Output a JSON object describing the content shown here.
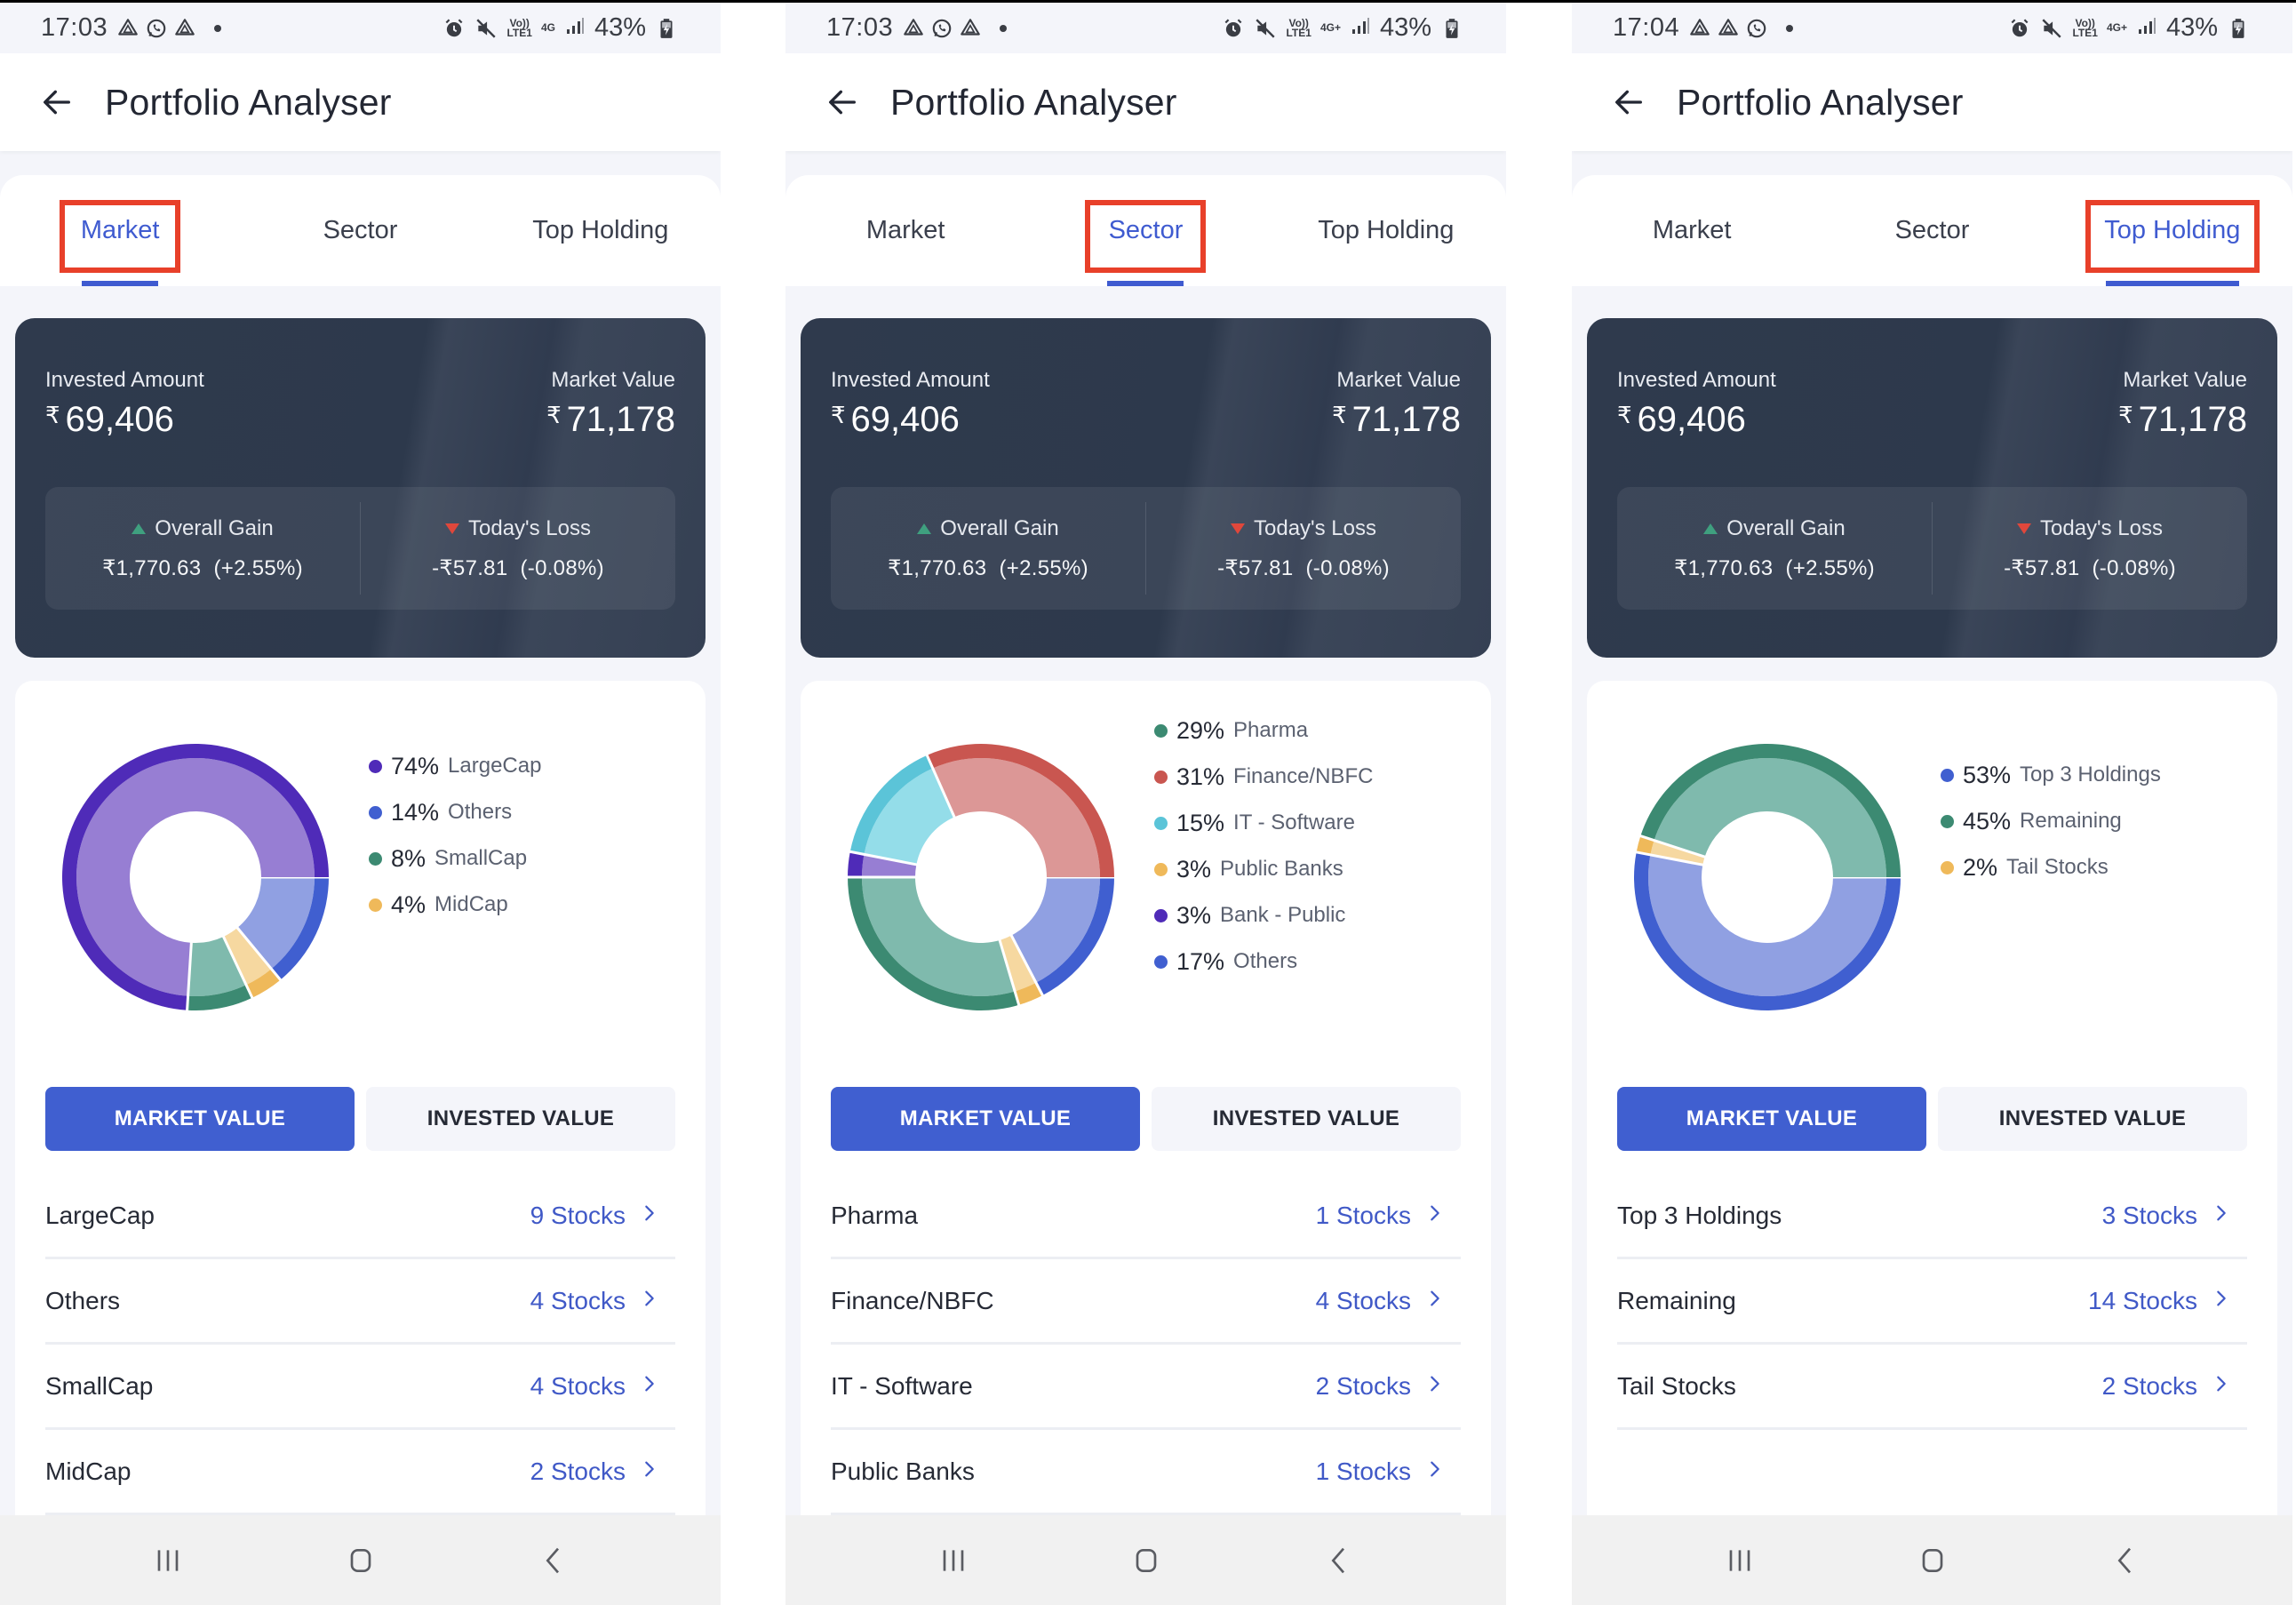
{
  "app": {
    "title": "Portfolio Analyser"
  },
  "tabs": [
    "Market",
    "Sector",
    "Top Holding"
  ],
  "summary": {
    "invested_label": "Invested Amount",
    "invested_value": "69,406",
    "market_label": "Market Value",
    "market_value": "71,178",
    "currency": "₹",
    "gain_label": "Overall Gain",
    "gain_value": "₹1,770.63",
    "gain_pct": "(+2.55%)",
    "loss_label": "Today's Loss",
    "loss_value": "-₹57.81",
    "loss_pct": "(-0.08%)"
  },
  "buttons": {
    "market_value": "MARKET VALUE",
    "invested_value": "INVESTED VALUE"
  },
  "nav": {
    "recents": "recents-icon",
    "home": "home-icon",
    "back": "back-icon"
  },
  "colors": {
    "accent": "#405fd0",
    "highlight": "#e8402a",
    "card_dark": "#2f3a4d",
    "gain": "#3fa07f",
    "loss": "#e0473b"
  },
  "panels": [
    {
      "status": {
        "time": "17:03",
        "network": "4G",
        "battery": "43%",
        "notif_icons": [
          "drive-icon",
          "whatsapp-icon",
          "drive-icon"
        ]
      },
      "active_tab": 0,
      "legend": [
        {
          "pct": "74%",
          "name": "LargeCap"
        },
        {
          "pct": "14%",
          "name": "Others"
        },
        {
          "pct": "8%",
          "name": "SmallCap"
        },
        {
          "pct": "4%",
          "name": "MidCap"
        }
      ],
      "rows": [
        {
          "name": "LargeCap",
          "count": "9 Stocks"
        },
        {
          "name": "Others",
          "count": "4 Stocks"
        },
        {
          "name": "SmallCap",
          "count": "4 Stocks"
        },
        {
          "name": "MidCap",
          "count": "2 Stocks"
        }
      ]
    },
    {
      "status": {
        "time": "17:03",
        "network": "4G+",
        "battery": "43%",
        "notif_icons": [
          "drive-icon",
          "whatsapp-icon",
          "drive-icon"
        ]
      },
      "active_tab": 1,
      "legend": [
        {
          "pct": "29%",
          "name": "Pharma"
        },
        {
          "pct": "31%",
          "name": "Finance/NBFC"
        },
        {
          "pct": "15%",
          "name": "IT - Software"
        },
        {
          "pct": "3%",
          "name": "Public Banks"
        },
        {
          "pct": "3%",
          "name": "Bank - Public"
        },
        {
          "pct": "17%",
          "name": "Others"
        }
      ],
      "rows": [
        {
          "name": "Pharma",
          "count": "1 Stocks"
        },
        {
          "name": "Finance/NBFC",
          "count": "4 Stocks"
        },
        {
          "name": "IT - Software",
          "count": "2 Stocks"
        },
        {
          "name": "Public Banks",
          "count": "1 Stocks"
        }
      ]
    },
    {
      "status": {
        "time": "17:04",
        "network": "4G+",
        "battery": "43%",
        "notif_icons": [
          "drive-icon",
          "drive-icon",
          "whatsapp-icon"
        ]
      },
      "active_tab": 2,
      "legend": [
        {
          "pct": "53%",
          "name": "Top 3 Holdings"
        },
        {
          "pct": "45%",
          "name": "Remaining"
        },
        {
          "pct": "2%",
          "name": "Tail Stocks"
        }
      ],
      "rows": [
        {
          "name": "Top 3 Holdings",
          "count": "3 Stocks"
        },
        {
          "name": "Remaining",
          "count": "14 Stocks"
        },
        {
          "name": "Tail Stocks",
          "count": "2 Stocks"
        }
      ]
    }
  ],
  "chart_data": [
    {
      "type": "pie",
      "title": "Market",
      "order_clockwise_from_3oclock": [
        "Others",
        "MidCap",
        "SmallCap",
        "LargeCap"
      ],
      "slices": [
        {
          "name": "LargeCap",
          "value": 74,
          "color": "#4f2bb8",
          "fill": "#977ed3"
        },
        {
          "name": "Others",
          "value": 14,
          "color": "#405fd0",
          "fill": "#90a0e2"
        },
        {
          "name": "SmallCap",
          "value": 8,
          "color": "#3c8a72",
          "fill": "#7fbaad"
        },
        {
          "name": "MidCap",
          "value": 4,
          "color": "#efb95a",
          "fill": "#f6d8a0"
        }
      ],
      "legend_position": "right"
    },
    {
      "type": "pie",
      "title": "Sector",
      "order_clockwise_from_3oclock": [
        "Others",
        "Public Banks",
        "Pharma",
        "Bank - Public",
        "IT - Software",
        "Finance/NBFC"
      ],
      "slices": [
        {
          "name": "Pharma",
          "value": 29,
          "color": "#3c8a72",
          "fill": "#7fbaad"
        },
        {
          "name": "Finance/NBFC",
          "value": 31,
          "color": "#c95650",
          "fill": "#dc9796"
        },
        {
          "name": "IT - Software",
          "value": 15,
          "color": "#5bc4d8",
          "fill": "#94dde9"
        },
        {
          "name": "Public Banks",
          "value": 3,
          "color": "#efb95a",
          "fill": "#f6d8a0"
        },
        {
          "name": "Bank - Public",
          "value": 3,
          "color": "#4f2bb8",
          "fill": "#977ed3"
        },
        {
          "name": "Others",
          "value": 17,
          "color": "#405fd0",
          "fill": "#90a0e2"
        }
      ],
      "legend_position": "right"
    },
    {
      "type": "pie",
      "title": "Top Holding",
      "order_clockwise_from_3oclock": [
        "Top 3 Holdings",
        "Tail Stocks",
        "Remaining"
      ],
      "slices": [
        {
          "name": "Top 3 Holdings",
          "value": 53,
          "color": "#405fd0",
          "fill": "#90a0e2"
        },
        {
          "name": "Remaining",
          "value": 45,
          "color": "#3c8a72",
          "fill": "#7fbaad"
        },
        {
          "name": "Tail Stocks",
          "value": 2,
          "color": "#efb95a",
          "fill": "#f6d8a0"
        }
      ],
      "legend_position": "right"
    }
  ]
}
